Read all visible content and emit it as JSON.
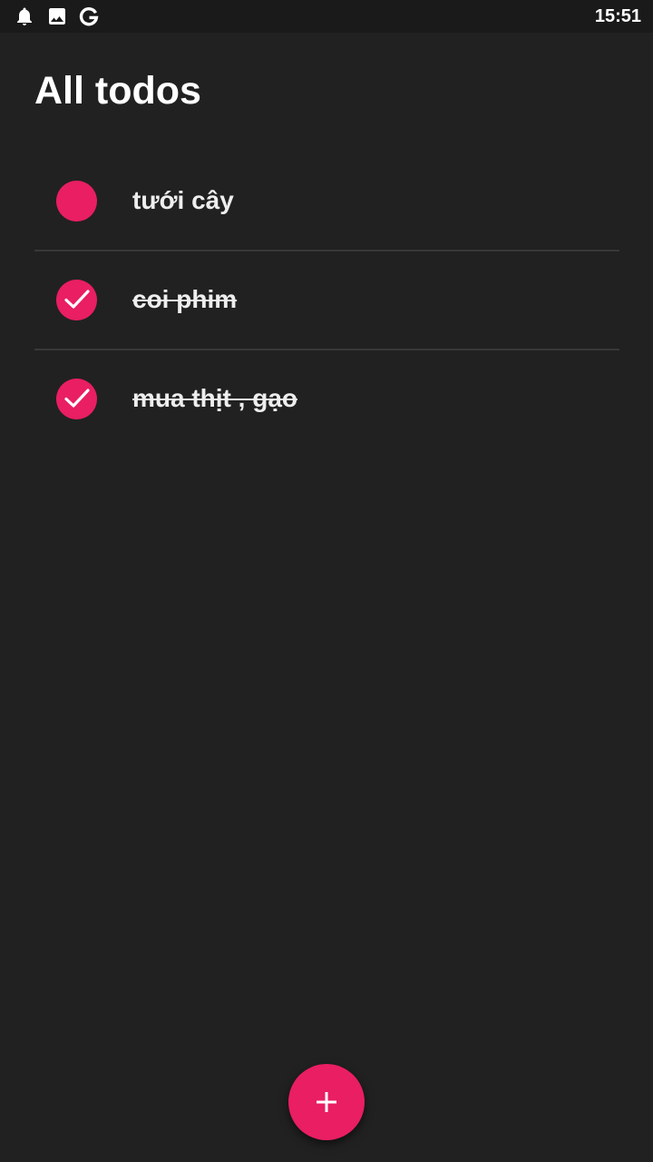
{
  "colors": {
    "background": "#212121",
    "status_bar": "#1a1a1a",
    "accent": "#e91e63",
    "divider": "#383838"
  },
  "status_bar": {
    "icons": [
      "notification-bell-icon",
      "image-icon",
      "google-icon"
    ],
    "time": "15:51"
  },
  "page": {
    "title": "All todos"
  },
  "todos": [
    {
      "label": "tưới cây",
      "completed": false
    },
    {
      "label": "coi phim",
      "completed": true
    },
    {
      "label": "mua thịt , gạo",
      "completed": true
    }
  ],
  "fab": {
    "icon": "plus-icon"
  }
}
